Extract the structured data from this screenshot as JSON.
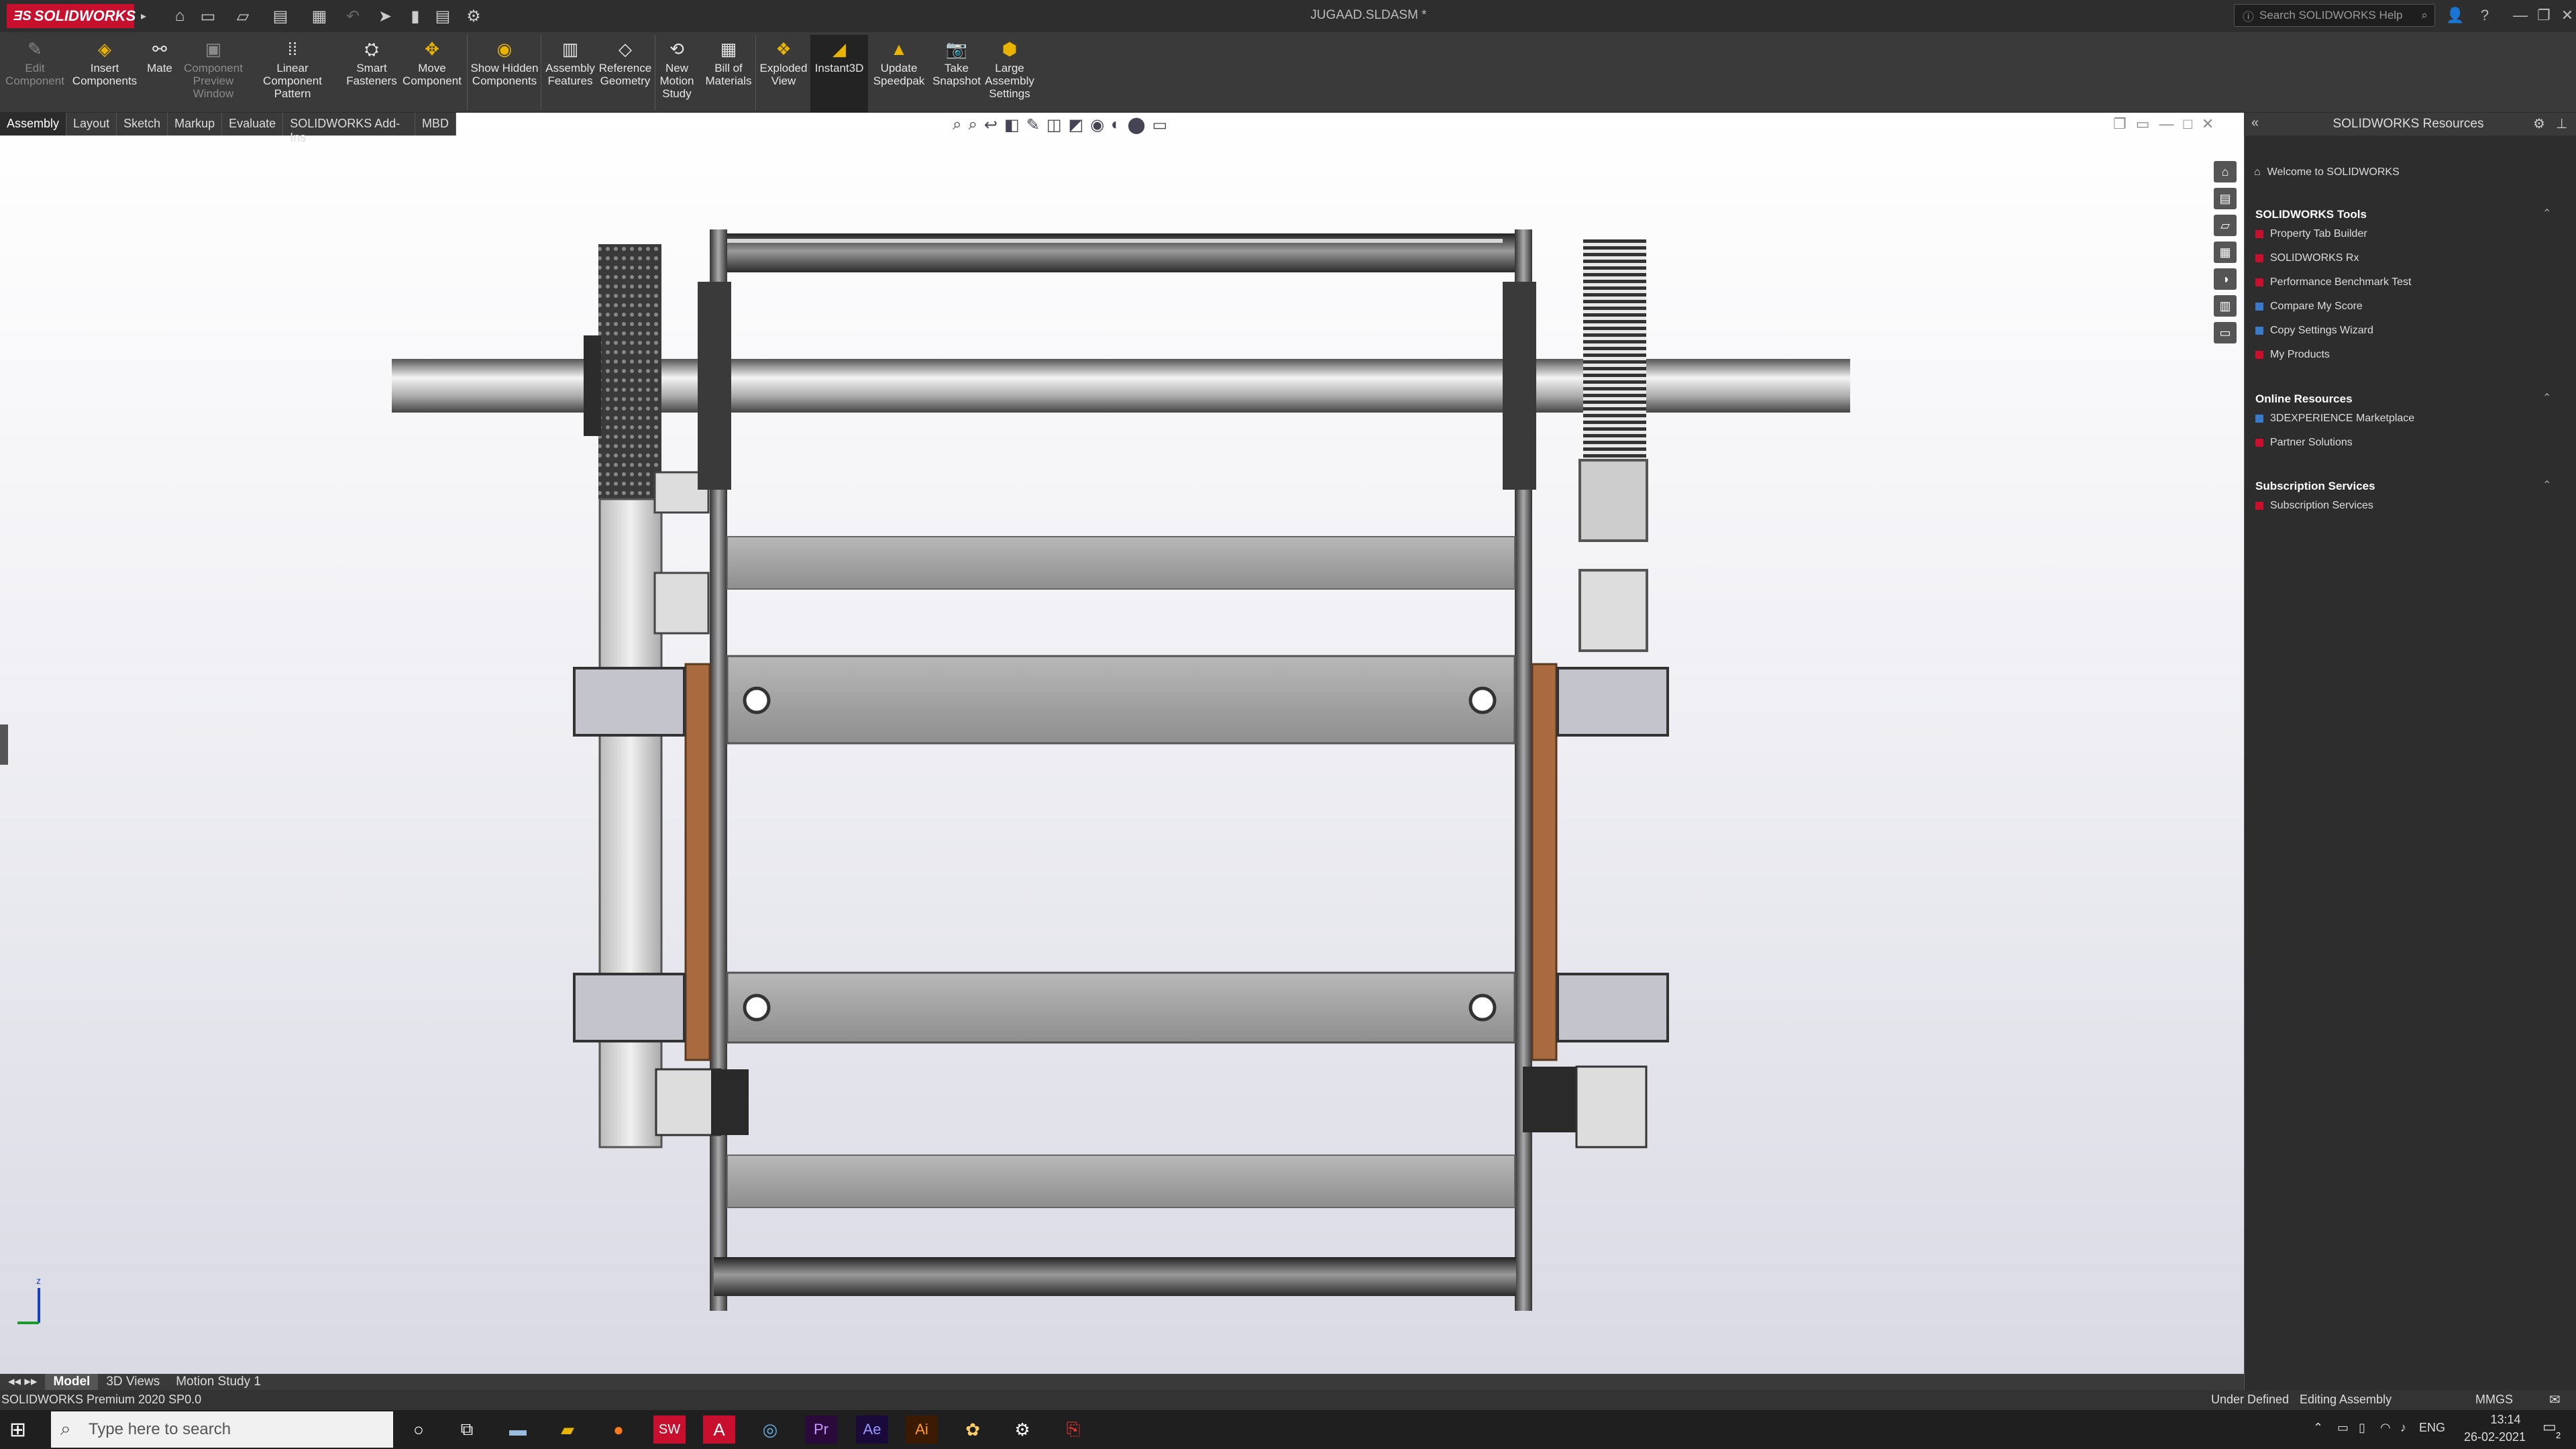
{
  "app": {
    "brand": "SOLIDWORKS",
    "document_title": "JUGAAD.SLDASM *"
  },
  "help_search": {
    "placeholder": "Search SOLIDWORKS Help"
  },
  "commands": [
    {
      "label": "Edit Component",
      "enabled": false,
      "icon": "edit-component-icon"
    },
    {
      "label": "Insert Components",
      "enabled": true,
      "icon": "insert-components-icon"
    },
    {
      "label": "Mate",
      "enabled": true,
      "icon": "mate-icon"
    },
    {
      "label": "Component Preview Window",
      "enabled": false,
      "icon": "preview-window-icon"
    },
    {
      "label": "Linear Component Pattern",
      "enabled": true,
      "icon": "linear-pattern-icon"
    },
    {
      "label": "Smart Fasteners",
      "enabled": true,
      "icon": "fasteners-icon"
    },
    {
      "label": "Move Component",
      "enabled": true,
      "icon": "move-component-icon"
    },
    {
      "label": "Show Hidden Components",
      "enabled": true,
      "icon": "show-hidden-icon"
    },
    {
      "label": "Assembly Features",
      "enabled": true,
      "icon": "assembly-features-icon"
    },
    {
      "label": "Reference Geometry",
      "enabled": true,
      "icon": "reference-geometry-icon"
    },
    {
      "label": "New Motion Study",
      "enabled": true,
      "icon": "motion-study-icon"
    },
    {
      "label": "Bill of Materials",
      "enabled": true,
      "icon": "bom-icon"
    },
    {
      "label": "Exploded View",
      "enabled": true,
      "icon": "exploded-view-icon"
    },
    {
      "label": "Instant3D",
      "enabled": true,
      "active": true,
      "icon": "instant3d-icon"
    },
    {
      "label": "Update Speedpak",
      "enabled": true,
      "icon": "speedpak-icon"
    },
    {
      "label": "Take Snapshot",
      "enabled": true,
      "icon": "camera-icon"
    },
    {
      "label": "Large Assembly Settings",
      "enabled": true,
      "icon": "large-assembly-icon"
    }
  ],
  "tabs": [
    "Assembly",
    "Layout",
    "Sketch",
    "Markup",
    "Evaluate",
    "SOLIDWORKS Add-Ins",
    "MBD"
  ],
  "active_tab": "Assembly",
  "bottom_tabs": [
    "Model",
    "3D Views",
    "Motion Study 1"
  ],
  "active_bottom_tab": "Model",
  "status": {
    "left": "SOLIDWORKS Premium 2020 SP0.0",
    "definition": "Under Defined",
    "mode": "Editing Assembly",
    "units": "MMGS"
  },
  "task_pane": {
    "title": "SOLIDWORKS Resources",
    "welcome": "Welcome to SOLIDWORKS",
    "sections": [
      {
        "title": "SOLIDWORKS Tools",
        "items": [
          "Property Tab Builder",
          "SOLIDWORKS Rx",
          "Performance Benchmark Test",
          "Compare My Score",
          "Copy Settings Wizard",
          "My Products"
        ]
      },
      {
        "title": "Online Resources",
        "items": [
          "3DEXPERIENCE Marketplace",
          "Partner Solutions"
        ]
      },
      {
        "title": "Subscription Services",
        "items": [
          "Subscription Services"
        ]
      }
    ]
  },
  "taskbar": {
    "search_placeholder": "Type here to search",
    "language": "ENG",
    "time": "13:14",
    "date": "26-02-2021",
    "notification_count": "2"
  },
  "triad": {
    "z": "z"
  },
  "colors": {
    "accent": "#c8102e",
    "toolbar": "#3a3a3a",
    "brass": "#a86a3e"
  }
}
